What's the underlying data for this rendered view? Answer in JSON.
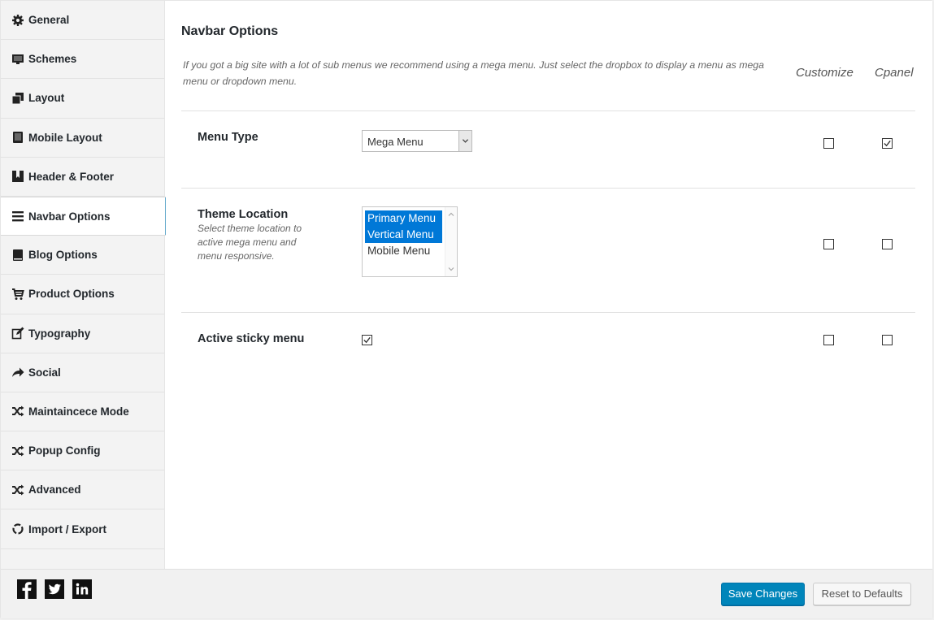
{
  "sidebar": {
    "items": [
      {
        "label": "General",
        "icon": "gear-icon"
      },
      {
        "label": "Schemes",
        "icon": "monitor-icon"
      },
      {
        "label": "Layout",
        "icon": "copy-icon"
      },
      {
        "label": "Mobile Layout",
        "icon": "tablet-icon"
      },
      {
        "label": "Header & Footer",
        "icon": "bookmark-icon"
      },
      {
        "label": "Navbar Options",
        "icon": "menu-icon"
      },
      {
        "label": "Blog Options",
        "icon": "book-icon"
      },
      {
        "label": "Product Options",
        "icon": "cart-icon"
      },
      {
        "label": "Typography",
        "icon": "edit-icon"
      },
      {
        "label": "Social",
        "icon": "share-icon"
      },
      {
        "label": "Maintaincece Mode",
        "icon": "shuffle-icon"
      },
      {
        "label": "Popup Config",
        "icon": "shuffle-icon"
      },
      {
        "label": "Advanced",
        "icon": "shuffle-icon"
      },
      {
        "label": "Import / Export",
        "icon": "refresh-icon"
      }
    ],
    "active_index": 5
  },
  "main": {
    "title": "Navbar Options",
    "description": "If you got a big site with a lot of sub menus we recommend using a mega menu. Just select the dropbox to display a menu as mega menu or dropdown menu.",
    "columns": {
      "customize": "Customize",
      "cpanel": "Cpanel"
    },
    "menu_type": {
      "label": "Menu Type",
      "value": "Mega Menu",
      "customize": false,
      "cpanel": true
    },
    "theme_location": {
      "label": "Theme Location",
      "description": "Select theme location to active mega menu and menu responsive.",
      "options": [
        {
          "label": "Primary Menu",
          "selected": true
        },
        {
          "label": "Vertical Menu",
          "selected": true
        },
        {
          "label": "Mobile Menu",
          "selected": false
        }
      ],
      "customize": false,
      "cpanel": false
    },
    "sticky_menu": {
      "label": "Active sticky menu",
      "enabled": true,
      "customize": false,
      "cpanel": false
    }
  },
  "footer": {
    "social": [
      {
        "name": "facebook-icon",
        "glyph": "f"
      },
      {
        "name": "twitter-icon",
        "glyph": "t"
      },
      {
        "name": "linkedin-icon",
        "glyph": "in"
      }
    ],
    "save_label": "Save Changes",
    "reset_label": "Reset to Defaults"
  },
  "colors": {
    "accent": "#0085ba",
    "selection": "#0078d7"
  }
}
